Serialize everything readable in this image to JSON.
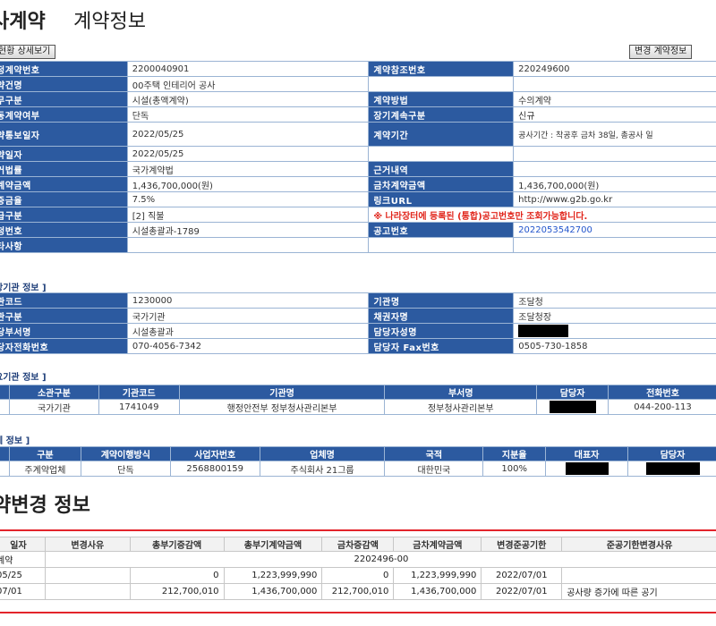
{
  "title": {
    "main": "사계약",
    "sub": "계약정보"
  },
  "buttons": {
    "left": "현황 상세보기",
    "right": "변경 계약정보"
  },
  "contract": [
    [
      "정계약번호",
      "2200040901",
      "계약참조번호",
      "220249600"
    ],
    [
      "약건명",
      "00주택 인테리어 공사",
      "",
      ""
    ],
    [
      "무구분",
      "시설(총액계약)",
      "계약방법",
      "수의계약"
    ],
    [
      "동계약여부",
      "단독",
      "장기계속구분",
      "신규"
    ],
    [
      "약통보일자",
      "2022/05/25",
      "계약기간",
      "공사기간 : 착공후 금차 38일, 총공사 일"
    ],
    [
      "약일자",
      "2022/05/25",
      "",
      ""
    ],
    [
      "거법률",
      "국가계약법",
      "근거내역",
      ""
    ],
    [
      "계약금액",
      "1,436,700,000(원)",
      "금차계약금액",
      "1,436,700,000(원)"
    ],
    [
      "증금율",
      "7.5%",
      "링크URL",
      "http://www.g2b.go.kr"
    ],
    [
      "급구분",
      "[2] 직불",
      "",
      ""
    ],
    [
      "청번호",
      "시설총괄과-1789",
      "공고번호",
      "2022053542700"
    ],
    [
      "타사항",
      "",
      "",
      ""
    ]
  ],
  "notice": "※ 나라장터에 등록된 (통합)공고번호만 조회가능합니다.",
  "section_agency": "장기관 정보 ]",
  "agency": [
    [
      "관코드",
      "1230000",
      "기관명",
      "조달청"
    ],
    [
      "관구분",
      "국가기관",
      "채권자명",
      "조달청장"
    ],
    [
      "당부서명",
      "시설총괄과",
      "담당자성명",
      ""
    ],
    [
      "당자전화번호",
      "070-4056-7342",
      "담당자 Fax번호",
      "0505-730-1858"
    ]
  ],
  "section_demand": "요기관 정보 ]",
  "demand": {
    "headers": [
      "소관구분",
      "기관코드",
      "기관명",
      "부서명",
      "담당자",
      "전화번호"
    ],
    "row": [
      "국가기관",
      "1741049",
      "행정안전부 정부청사관리본부",
      "정부청사관리본부",
      "",
      "044-200-113"
    ]
  },
  "section_company": "체 정보 ]",
  "company": {
    "headers": [
      "구분",
      "계약이행방식",
      "사업자번호",
      "업체명",
      "국적",
      "지분율",
      "대표자",
      "담당자"
    ],
    "row": [
      "주계약업체",
      "단독",
      "2568800159",
      "주식회사 21그룹",
      "대한민국",
      "100%",
      "",
      ""
    ]
  },
  "change_title": "약변경 정보",
  "changes": {
    "headers": [
      "일자",
      "변경사유",
      "총부기증감액",
      "총부기계약금액",
      "금차증감액",
      "금차계약금액",
      "변경준공기한",
      "준공기한변경사유"
    ],
    "rows": [
      [
        "계약",
        "",
        "",
        "",
        "",
        "",
        "",
        ""
      ],
      [
        "05/25",
        "",
        "0",
        "1,223,999,990",
        "0",
        "1,223,999,990",
        "2022/07/01",
        ""
      ],
      [
        "07/01",
        "",
        "212,700,010",
        "1,436,700,000",
        "212,700,010",
        "1,436,700,000",
        "2022/07/01",
        "공사량 증가에 따른 공기"
      ]
    ],
    "merged_contract_no": "2202496-00"
  }
}
